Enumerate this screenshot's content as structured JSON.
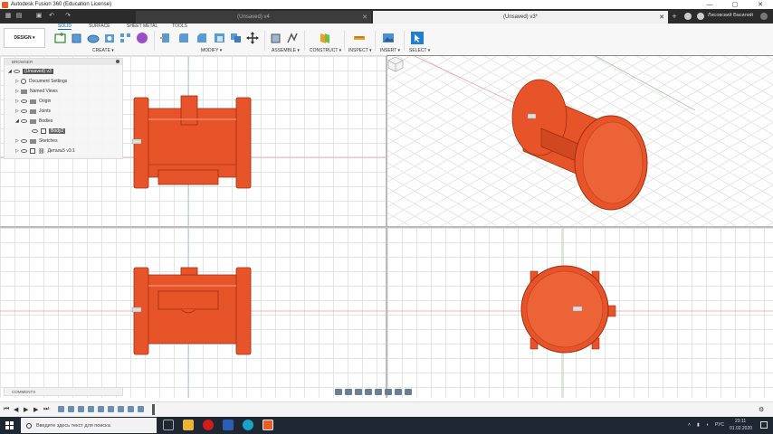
{
  "window": {
    "title": "Autodesk Fusion 360 (Education License)",
    "controls": [
      "—",
      "▢",
      "✕"
    ]
  },
  "tabs": [
    {
      "label": "(Unsaved) v4",
      "active": false
    },
    {
      "label": "(Unsaved) v3*",
      "active": true
    }
  ],
  "user": {
    "name": "Лисовский Василий"
  },
  "toolbar": {
    "workspace_button": "DESIGN ▾",
    "workspace_tabs": [
      "SOLID",
      "SURFACE",
      "SHEET METAL",
      "TOOLS"
    ],
    "groups": [
      "CREATE ▾",
      "MODIFY ▾",
      "ASSEMBLE ▾",
      "CONSTRUCT ▾",
      "INSPECT ▾",
      "INSERT ▾",
      "SELECT ▾"
    ]
  },
  "browser": {
    "title": "BROWSER",
    "root": "(Unsaved) v3",
    "items": [
      "Document Settings",
      "Named Views",
      "Origin",
      "Joints",
      "Bodies",
      "Body2",
      "Sketches",
      "Деталь5 v3:1"
    ]
  },
  "comments": {
    "label": "COMMENTS"
  },
  "taskbar": {
    "search_placeholder": "Введите здесь текст для поиска",
    "lang": "РУС",
    "time": "23:11",
    "date": "01.02.2020"
  },
  "colors": {
    "part_orange": "#e8542a",
    "part_edge": "#9c2e10",
    "accent_blue": "#0a6ebd"
  }
}
